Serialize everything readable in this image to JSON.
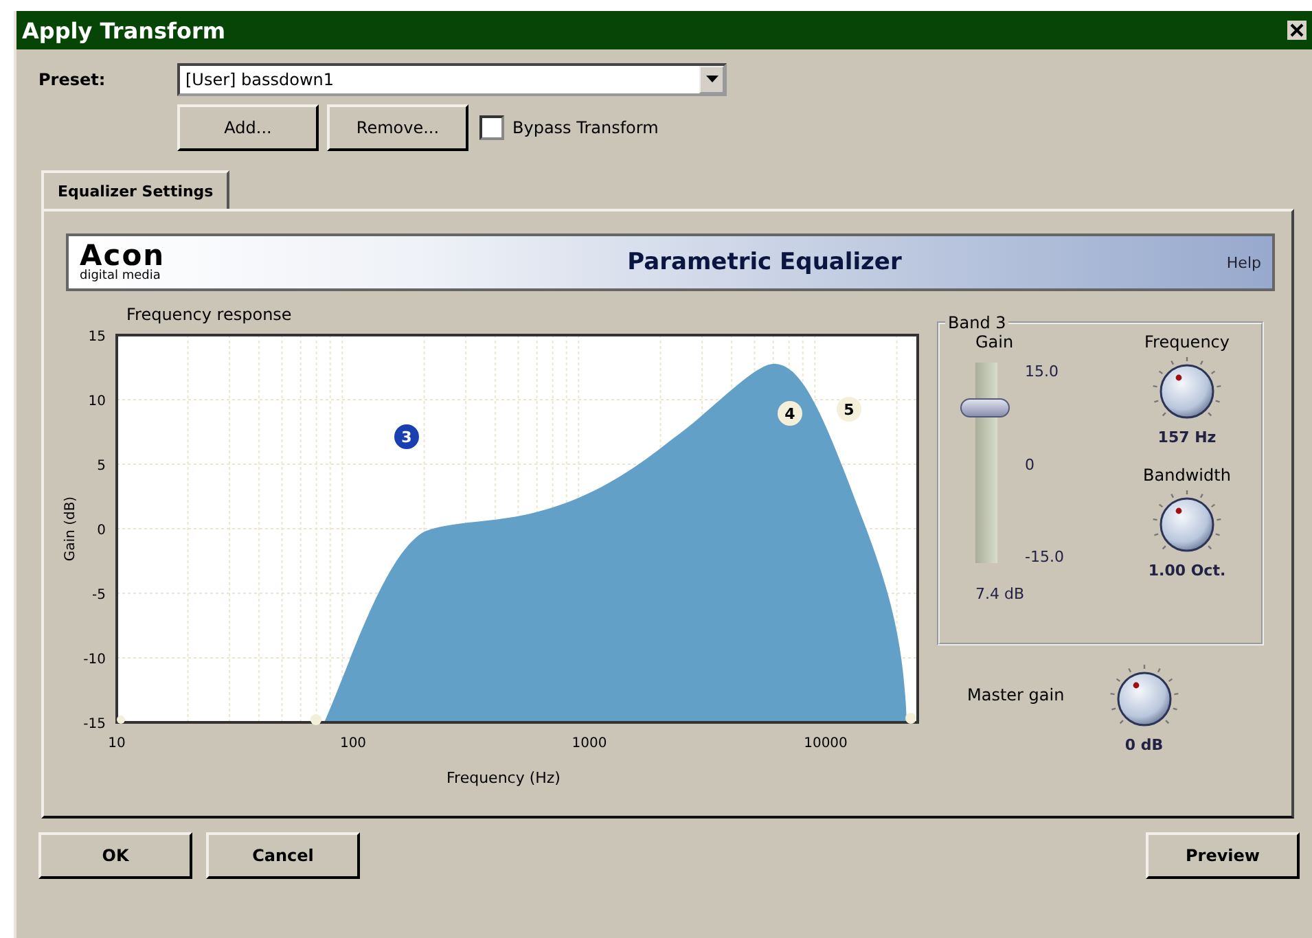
{
  "window": {
    "title": "Apply Transform"
  },
  "preset": {
    "label": "Preset:",
    "value": "[User] bassdown1"
  },
  "preset_buttons": [
    "Add...",
    "Remove..."
  ],
  "bypass": {
    "label": "Bypass Transform",
    "checked": false
  },
  "tabs": [
    {
      "label": "Equalizer Settings",
      "selected": true
    }
  ],
  "plugin": {
    "logo": "Acon",
    "logo_sub": "digital media",
    "title": "Parametric Equalizer",
    "help": "Help"
  },
  "response": {
    "title": "Frequency response",
    "ylabel": "Gain (dB)",
    "xlabel": "Frequency (Hz)",
    "yticks": [
      "15",
      "10",
      "5",
      "0",
      "-5",
      "-10",
      "-15"
    ],
    "xticks": [
      "10",
      "100",
      "1000",
      "10000"
    ],
    "handles": [
      {
        "label": "3",
        "selected": true
      },
      {
        "label": "4",
        "selected": false
      },
      {
        "label": "5",
        "selected": false
      }
    ]
  },
  "band": {
    "title": "Band 3",
    "gain": {
      "label": "Gain",
      "max": "15.0",
      "mid": "0",
      "min": "-15.0",
      "level": 0.747,
      "reading": "7.4 dB"
    },
    "frequency": {
      "label": "Frequency",
      "reading": "157 Hz"
    },
    "bandwidth": {
      "label": "Bandwidth",
      "reading": "1.00 Oct."
    }
  },
  "master": {
    "label": "Master gain",
    "reading": "0 dB"
  },
  "footer_left": [
    "OK",
    "Cancel"
  ],
  "footer_right": [
    "Preview"
  ]
}
